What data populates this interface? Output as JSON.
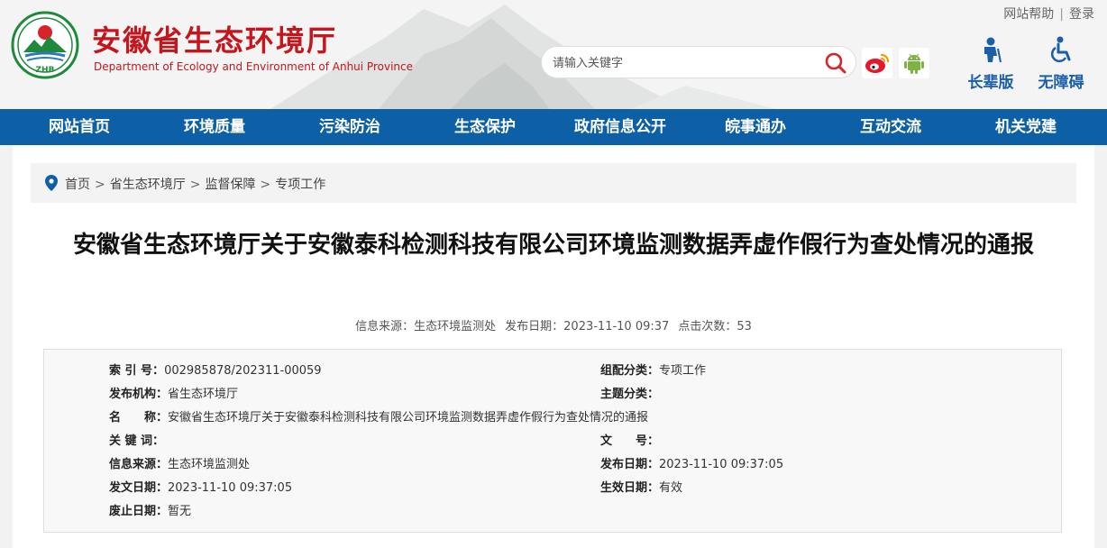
{
  "header": {
    "title": "安徽省生态环境厅",
    "subtitle": "Department of Ecology and Environment of Anhui Province",
    "logo_text": "ZHB",
    "top_links": [
      "网站帮助",
      "登录"
    ],
    "search_placeholder": "请输入关键字",
    "elder_label": "长辈版",
    "access_label": "无障碍"
  },
  "nav": [
    "网站首页",
    "环境质量",
    "污染防治",
    "生态保护",
    "政府信息公开",
    "皖事通办",
    "互动交流",
    "机关党建"
  ],
  "breadcrumb": [
    "首页",
    "省生态环境厅",
    "监督保障",
    "专项工作"
  ],
  "breadcrumb_sep": ">",
  "article": {
    "title": "安徽省生态环境厅关于安徽泰科检测科技有限公司环境监测数据弄虚作假行为查处情况的通报",
    "source": "信息来源：生态环境监测处",
    "date": "发布日期：2023-11-10 09:37",
    "clicks": "点击次数：53"
  },
  "info": {
    "index_key": "索 引 号：",
    "index_val": "002985878/202311-00059",
    "cat_key": "组配分类：",
    "cat_val": "专项工作",
    "org_key": "发布机构：",
    "org_val": "省生态环境厅",
    "topic_key": "主题分类：",
    "topic_val": "",
    "name_key": "名　　称：",
    "name_val": "安徽省生态环境厅关于安徽泰科检测科技有限公司环境监测数据弄虚作假行为查处情况的通报",
    "kw_key": "关 键 词：",
    "kw_val": "",
    "docno_key": "文　　号：",
    "docno_val": "",
    "src_key": "信息来源：",
    "src_val": "生态环境监测处",
    "pub_key": "发布日期：",
    "pub_val": "2023-11-10 09:37:05",
    "issue_key": "发文日期：",
    "issue_val": "2023-11-10 09:37:05",
    "eff_key": "生效日期：",
    "eff_val": "有效",
    "abol_key": "废止日期：",
    "abol_val": "暂无"
  },
  "colors": {
    "brand_red": "#c4161c",
    "nav_blue": "#0d5fa6",
    "aux_blue": "#1b5fa8"
  }
}
